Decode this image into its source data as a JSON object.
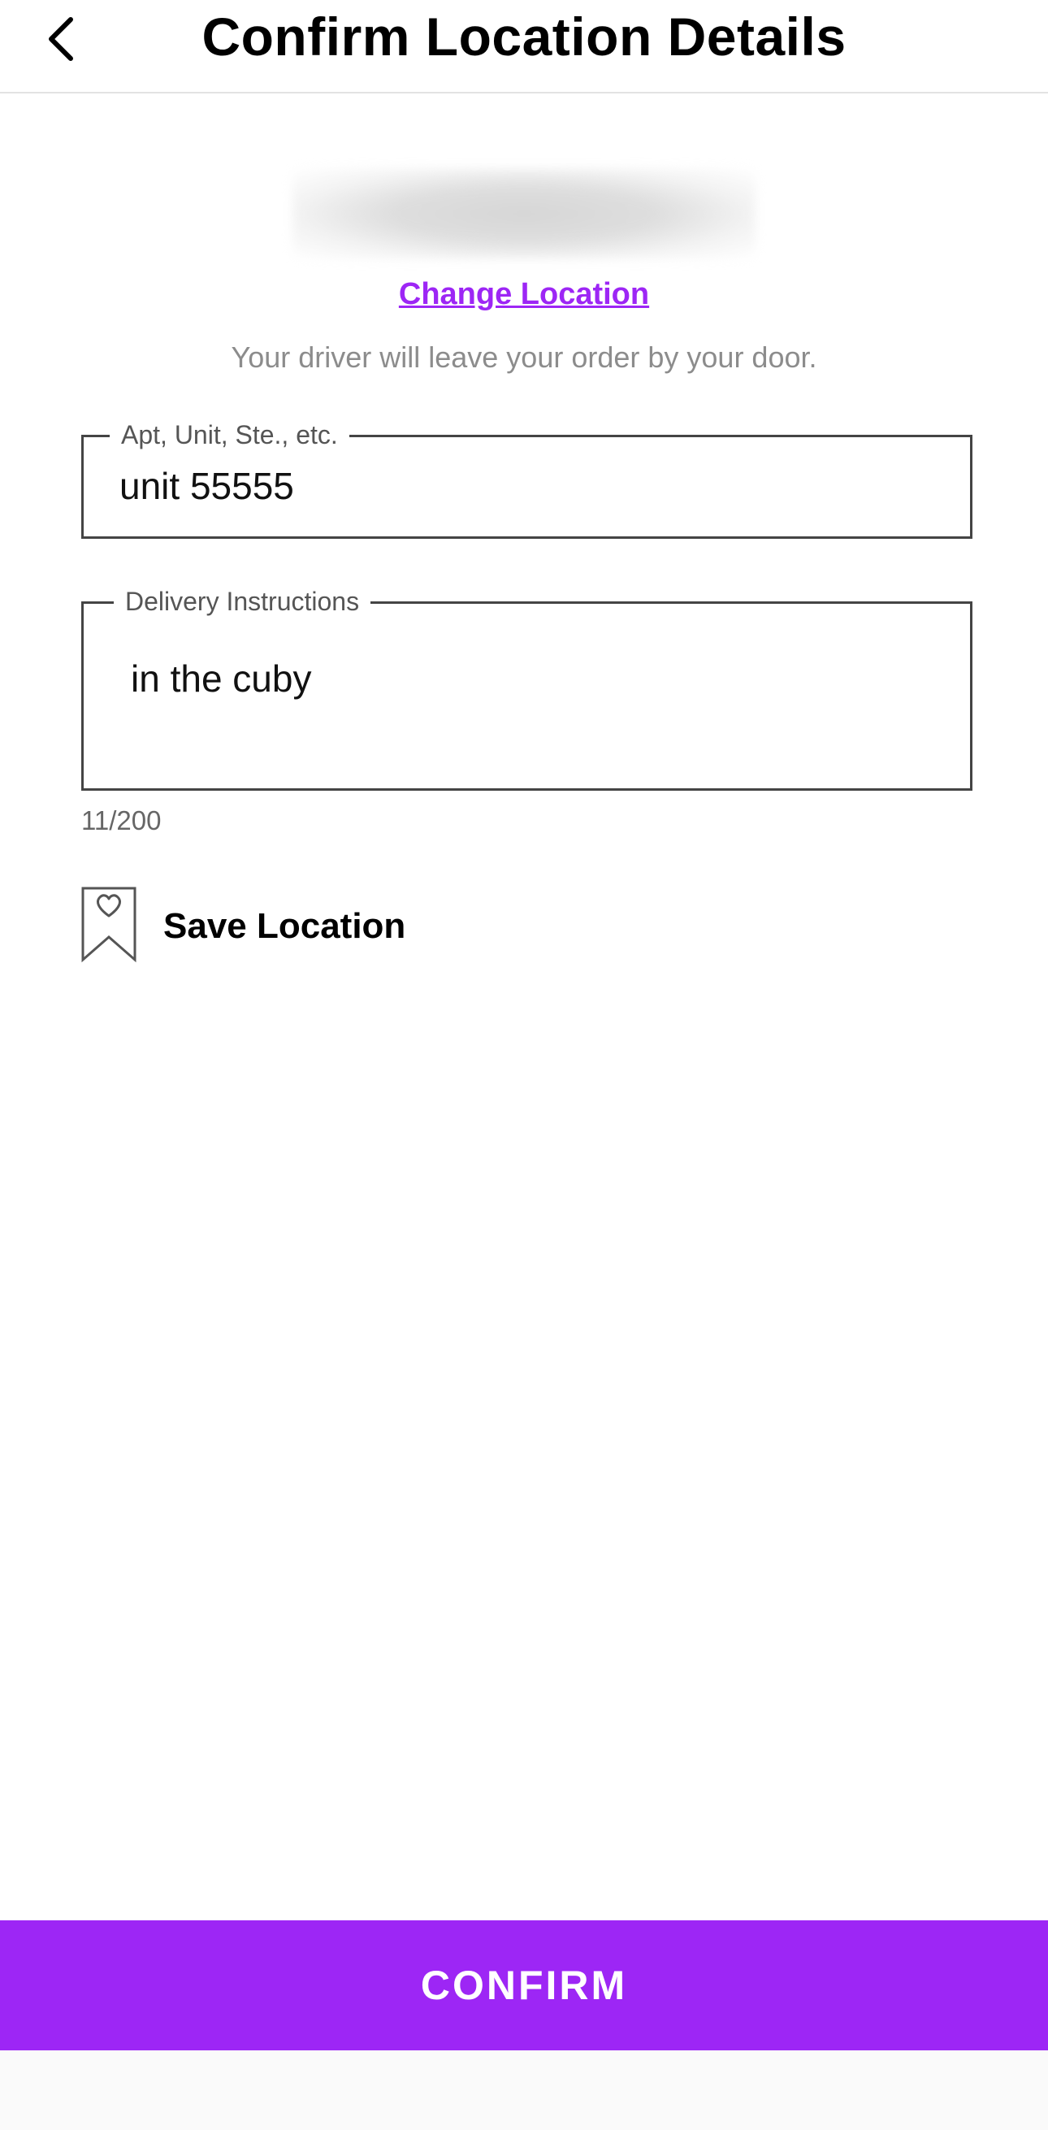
{
  "header": {
    "title": "Confirm Location Details",
    "back_icon": "chevron-left-icon"
  },
  "location": {
    "change_label": "Change Location",
    "driver_note": "Your driver will leave your order by your door."
  },
  "apt_field": {
    "label": "Apt, Unit, Ste., etc.",
    "value": "unit 55555"
  },
  "instructions_field": {
    "label": "Delivery Instructions",
    "value": "in the cuby",
    "char_count": "11/200"
  },
  "save_location": {
    "label": "Save Location",
    "icon": "bookmark-heart-icon"
  },
  "confirm_button": {
    "label": "CONFIRM"
  },
  "colors": {
    "accent": "#9d26f5",
    "muted_text": "#8c8c8c",
    "border": "#444444"
  }
}
